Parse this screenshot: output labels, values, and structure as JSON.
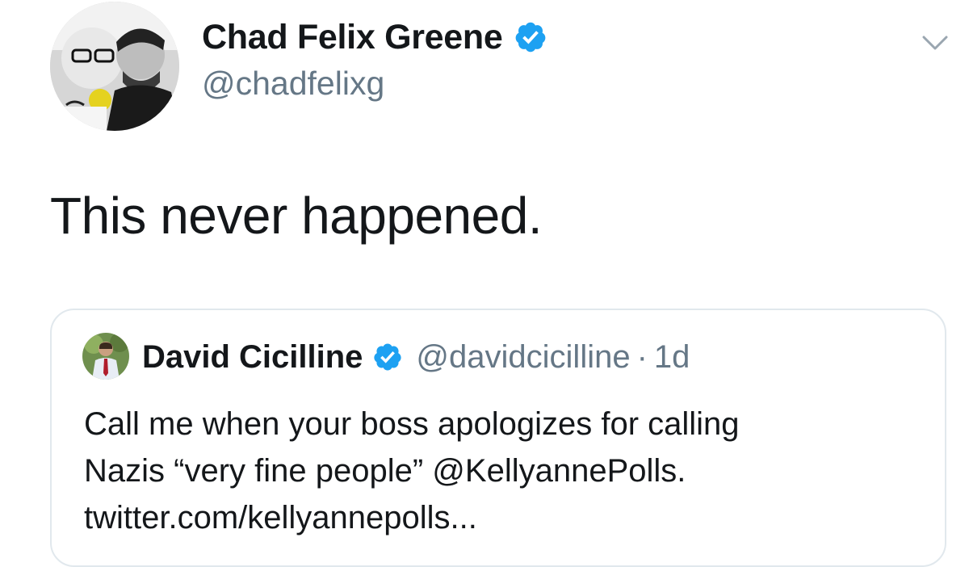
{
  "tweet": {
    "author": {
      "display_name": "Chad Felix Greene",
      "handle": "@chadfelixg",
      "verified": true
    },
    "text": "This never happened.",
    "menu_icon": "chevron-down-icon"
  },
  "quoted_tweet": {
    "author": {
      "display_name": "David Cicilline",
      "handle": "@davidcicilline",
      "verified": true
    },
    "separator": "·",
    "time": "1d",
    "text_lines": [
      "Call me when your boss apologizes for calling",
      "Nazis “very fine people” @KellyannePolls.",
      "twitter.com/kellyannepolls..."
    ]
  },
  "colors": {
    "verified_blue": "#1da1f2",
    "secondary_text": "#657786",
    "primary_text": "#14171a",
    "border": "#e1e8ed"
  }
}
